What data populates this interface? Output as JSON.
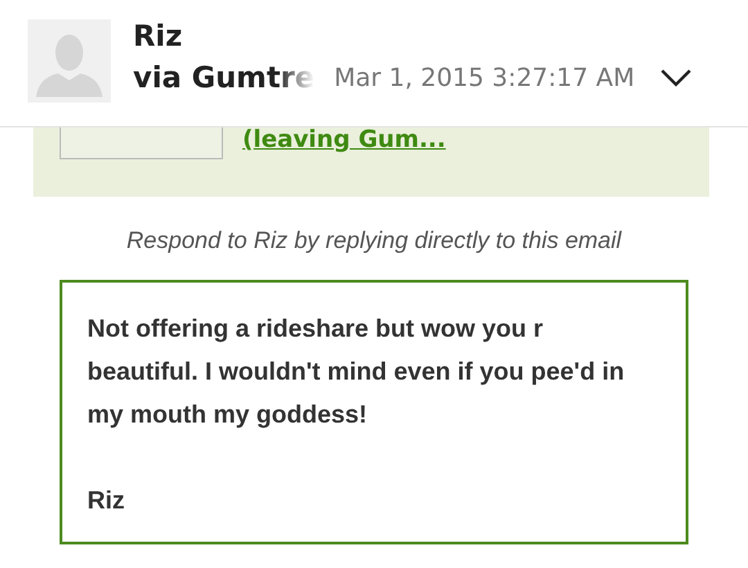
{
  "sender": {
    "name": "Riz",
    "via": "via Gumtre",
    "date": "Mar 1, 2015 3:27:17 AM"
  },
  "banner": {
    "link": "(leaving Gum..."
  },
  "notice": "Respond to Riz by replying directly to this email",
  "message": {
    "lines": [
      "Not offering a rideshare but wow you r beautiful. I wouldn't mind even if you pee'd in my mouth my goddess!"
    ],
    "signature": "Riz"
  }
}
